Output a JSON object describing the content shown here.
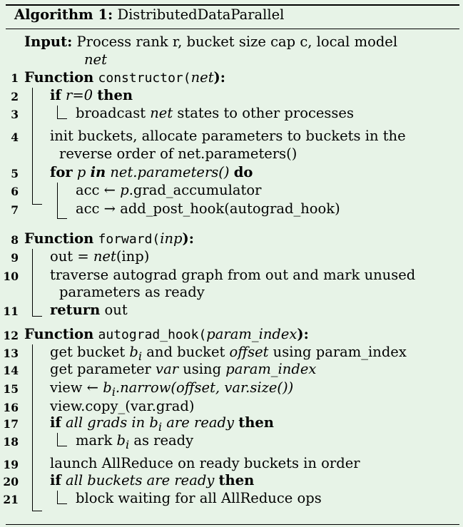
{
  "algorithm": {
    "label": "Algorithm 1:",
    "name": "DistributedDataParallel",
    "input_label": "Input:",
    "input_text": "Process rank r, bucket size cap c, local model",
    "input_text2": "net"
  },
  "lines": {
    "l1": {
      "num": "1",
      "kw": "Function",
      "fn": "constructor",
      "arg": "net",
      "open": "(",
      "close": "):"
    },
    "l2": {
      "num": "2",
      "kw": "if",
      "cond": "r=0",
      "then": "then"
    },
    "l3": {
      "num": "3",
      "text_a": "broadcast",
      "text_b": "net",
      "text_c": "states to other processes"
    },
    "l4": {
      "num": "4",
      "text": "init buckets, allocate parameters to buckets in the",
      "text2": "reverse order of net.parameters()"
    },
    "l5": {
      "num": "5",
      "kw": "for",
      "p": "p",
      "in": "in",
      "iter": "net.parameters()",
      "do": "do"
    },
    "l6": {
      "num": "6",
      "text_a": "acc ← ",
      "text_b": "p",
      "text_c": ".grad_accumulator"
    },
    "l7": {
      "num": "7",
      "text": "acc → add_post_hook(autograd_hook)"
    },
    "l8": {
      "num": "8",
      "kw": "Function",
      "fn": "forward",
      "arg": "inp",
      "open": "(",
      "close": "):"
    },
    "l9": {
      "num": "9",
      "text_a": "out = ",
      "text_b": "net",
      "text_c": "(inp)"
    },
    "l10": {
      "num": "10",
      "text": "traverse autograd graph from out and mark unused",
      "text2": "parameters as ready"
    },
    "l11": {
      "num": "11",
      "kw": "return",
      "text": "out"
    },
    "l12": {
      "num": "12",
      "kw": "Function",
      "fn": "autograd_hook",
      "arg": "param_index",
      "open": "(",
      "close": "):"
    },
    "l13": {
      "num": "13",
      "text_a": "get bucket ",
      "text_b": "b",
      "sub": "i",
      "text_c": " and bucket ",
      "text_d": "offset",
      "text_e": " using param_index"
    },
    "l14": {
      "num": "14",
      "text_a": "get parameter ",
      "text_b": "var",
      "text_c": " using ",
      "text_d": "param_index"
    },
    "l15": {
      "num": "15",
      "text_a": "view ← ",
      "text_b": "b",
      "sub": "i",
      "text_c": ".narrow(offset, var.size())"
    },
    "l16": {
      "num": "16",
      "text": "view.copy_(var.grad)"
    },
    "l17": {
      "num": "17",
      "kw": "if",
      "cond_a": "all grads in ",
      "cond_b": "b",
      "sub": "i",
      "cond_c": " are ready",
      "then": "then"
    },
    "l18": {
      "num": "18",
      "text_a": "mark ",
      "text_b": "b",
      "sub": "i",
      "text_c": " as ready"
    },
    "l19": {
      "num": "19",
      "text": "launch AllReduce on ready buckets in order"
    },
    "l20": {
      "num": "20",
      "kw": "if",
      "cond": "all buckets are ready",
      "then": "then"
    },
    "l21": {
      "num": "21",
      "text": "block waiting for all AllReduce ops"
    }
  }
}
